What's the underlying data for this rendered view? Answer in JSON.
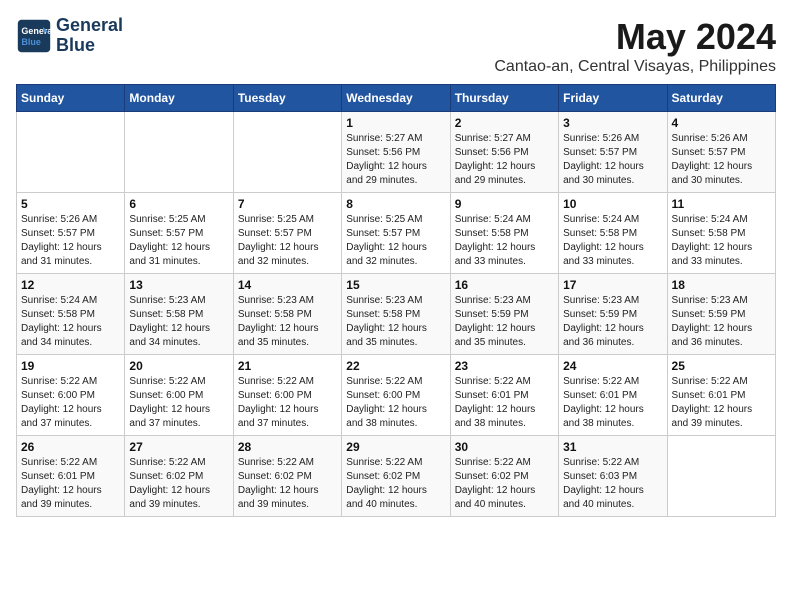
{
  "logo": {
    "line1": "General",
    "line2": "Blue"
  },
  "title": "May 2024",
  "subtitle": "Cantao-an, Central Visayas, Philippines",
  "days_of_week": [
    "Sunday",
    "Monday",
    "Tuesday",
    "Wednesday",
    "Thursday",
    "Friday",
    "Saturday"
  ],
  "weeks": [
    [
      {
        "day": "",
        "info": ""
      },
      {
        "day": "",
        "info": ""
      },
      {
        "day": "",
        "info": ""
      },
      {
        "day": "1",
        "info": "Sunrise: 5:27 AM\nSunset: 5:56 PM\nDaylight: 12 hours\nand 29 minutes."
      },
      {
        "day": "2",
        "info": "Sunrise: 5:27 AM\nSunset: 5:56 PM\nDaylight: 12 hours\nand 29 minutes."
      },
      {
        "day": "3",
        "info": "Sunrise: 5:26 AM\nSunset: 5:57 PM\nDaylight: 12 hours\nand 30 minutes."
      },
      {
        "day": "4",
        "info": "Sunrise: 5:26 AM\nSunset: 5:57 PM\nDaylight: 12 hours\nand 30 minutes."
      }
    ],
    [
      {
        "day": "5",
        "info": "Sunrise: 5:26 AM\nSunset: 5:57 PM\nDaylight: 12 hours\nand 31 minutes."
      },
      {
        "day": "6",
        "info": "Sunrise: 5:25 AM\nSunset: 5:57 PM\nDaylight: 12 hours\nand 31 minutes."
      },
      {
        "day": "7",
        "info": "Sunrise: 5:25 AM\nSunset: 5:57 PM\nDaylight: 12 hours\nand 32 minutes."
      },
      {
        "day": "8",
        "info": "Sunrise: 5:25 AM\nSunset: 5:57 PM\nDaylight: 12 hours\nand 32 minutes."
      },
      {
        "day": "9",
        "info": "Sunrise: 5:24 AM\nSunset: 5:58 PM\nDaylight: 12 hours\nand 33 minutes."
      },
      {
        "day": "10",
        "info": "Sunrise: 5:24 AM\nSunset: 5:58 PM\nDaylight: 12 hours\nand 33 minutes."
      },
      {
        "day": "11",
        "info": "Sunrise: 5:24 AM\nSunset: 5:58 PM\nDaylight: 12 hours\nand 33 minutes."
      }
    ],
    [
      {
        "day": "12",
        "info": "Sunrise: 5:24 AM\nSunset: 5:58 PM\nDaylight: 12 hours\nand 34 minutes."
      },
      {
        "day": "13",
        "info": "Sunrise: 5:23 AM\nSunset: 5:58 PM\nDaylight: 12 hours\nand 34 minutes."
      },
      {
        "day": "14",
        "info": "Sunrise: 5:23 AM\nSunset: 5:58 PM\nDaylight: 12 hours\nand 35 minutes."
      },
      {
        "day": "15",
        "info": "Sunrise: 5:23 AM\nSunset: 5:58 PM\nDaylight: 12 hours\nand 35 minutes."
      },
      {
        "day": "16",
        "info": "Sunrise: 5:23 AM\nSunset: 5:59 PM\nDaylight: 12 hours\nand 35 minutes."
      },
      {
        "day": "17",
        "info": "Sunrise: 5:23 AM\nSunset: 5:59 PM\nDaylight: 12 hours\nand 36 minutes."
      },
      {
        "day": "18",
        "info": "Sunrise: 5:23 AM\nSunset: 5:59 PM\nDaylight: 12 hours\nand 36 minutes."
      }
    ],
    [
      {
        "day": "19",
        "info": "Sunrise: 5:22 AM\nSunset: 6:00 PM\nDaylight: 12 hours\nand 37 minutes."
      },
      {
        "day": "20",
        "info": "Sunrise: 5:22 AM\nSunset: 6:00 PM\nDaylight: 12 hours\nand 37 minutes."
      },
      {
        "day": "21",
        "info": "Sunrise: 5:22 AM\nSunset: 6:00 PM\nDaylight: 12 hours\nand 37 minutes."
      },
      {
        "day": "22",
        "info": "Sunrise: 5:22 AM\nSunset: 6:00 PM\nDaylight: 12 hours\nand 38 minutes."
      },
      {
        "day": "23",
        "info": "Sunrise: 5:22 AM\nSunset: 6:01 PM\nDaylight: 12 hours\nand 38 minutes."
      },
      {
        "day": "24",
        "info": "Sunrise: 5:22 AM\nSunset: 6:01 PM\nDaylight: 12 hours\nand 38 minutes."
      },
      {
        "day": "25",
        "info": "Sunrise: 5:22 AM\nSunset: 6:01 PM\nDaylight: 12 hours\nand 39 minutes."
      }
    ],
    [
      {
        "day": "26",
        "info": "Sunrise: 5:22 AM\nSunset: 6:01 PM\nDaylight: 12 hours\nand 39 minutes."
      },
      {
        "day": "27",
        "info": "Sunrise: 5:22 AM\nSunset: 6:02 PM\nDaylight: 12 hours\nand 39 minutes."
      },
      {
        "day": "28",
        "info": "Sunrise: 5:22 AM\nSunset: 6:02 PM\nDaylight: 12 hours\nand 39 minutes."
      },
      {
        "day": "29",
        "info": "Sunrise: 5:22 AM\nSunset: 6:02 PM\nDaylight: 12 hours\nand 40 minutes."
      },
      {
        "day": "30",
        "info": "Sunrise: 5:22 AM\nSunset: 6:02 PM\nDaylight: 12 hours\nand 40 minutes."
      },
      {
        "day": "31",
        "info": "Sunrise: 5:22 AM\nSunset: 6:03 PM\nDaylight: 12 hours\nand 40 minutes."
      },
      {
        "day": "",
        "info": ""
      }
    ]
  ]
}
